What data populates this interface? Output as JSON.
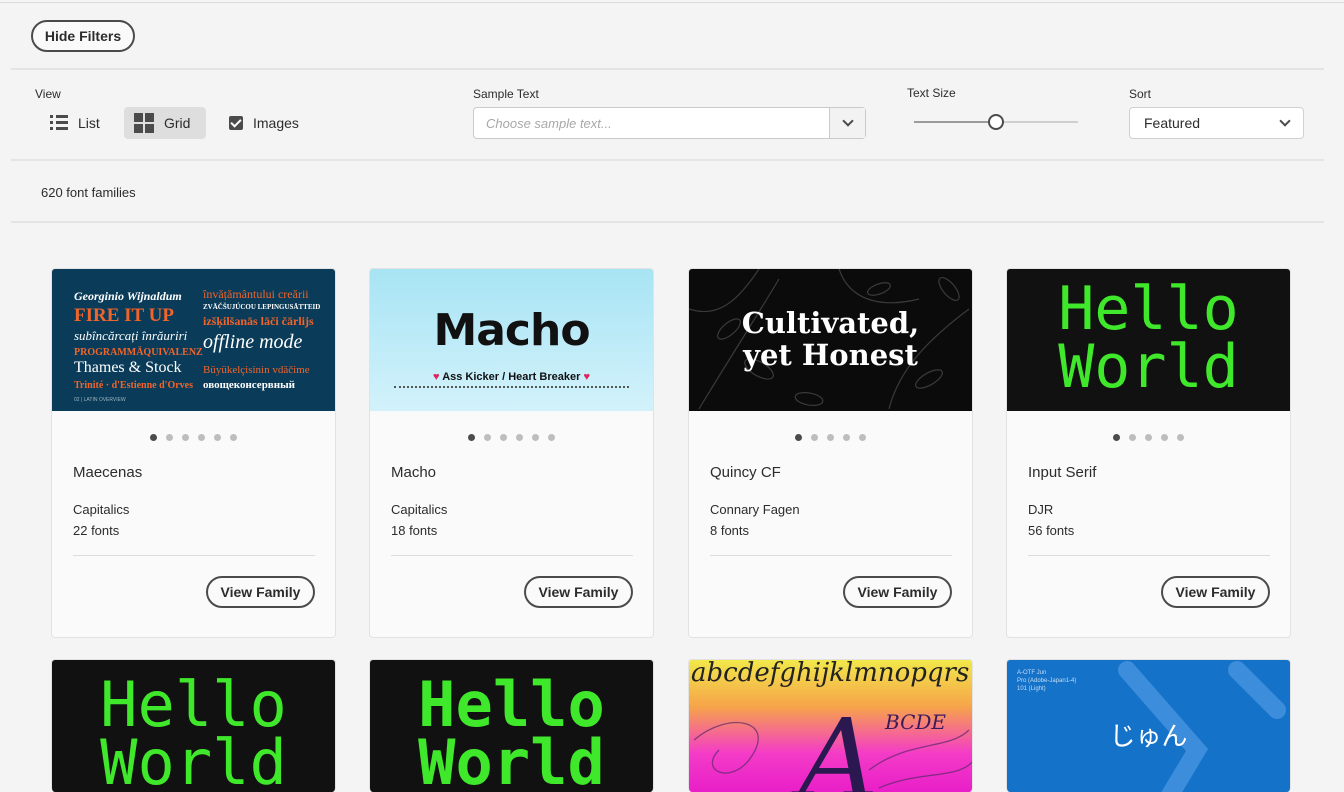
{
  "toolbar": {
    "hide_filters": "Hide Filters"
  },
  "filters": {
    "view_label": "View",
    "list_label": "List",
    "grid_label": "Grid",
    "images_label": "Images",
    "images_checked": true,
    "sample_text_label": "Sample Text",
    "sample_placeholder": "Choose sample text...",
    "text_size_label": "Text Size",
    "text_size_level": 0.5,
    "sort_label": "Sort",
    "sort_value": "Featured"
  },
  "results": {
    "count_text": "620 font families"
  },
  "cards": [
    {
      "name": "Maecenas",
      "foundry": "Capitalics",
      "fonts": "22 fonts",
      "button": "View Family",
      "thumb_lines": [
        "Georginio Wijnaldum",
        "FIRE IT UP",
        "subîncărcați înrăuriri",
        "PROGRAMMÄQUIVALENZ",
        "Thames & Stock",
        "Trinité · d'Estienne d'Orves",
        "învățământului creării",
        "ZVÄČŠUJÚCOU LEPINGUSÄTTEID",
        "izšķilšanās lāči čārlijs",
        "offline mode",
        "Büyükelçisinin vdăčime",
        "овощеконсервный",
        "02 | LATIN OVERVIEW"
      ]
    },
    {
      "name": "Macho",
      "foundry": "Capitalics",
      "fonts": "18 fonts",
      "button": "View Family",
      "thumb_title": "Macho",
      "thumb_sub": "Ass Kicker / Heart Breaker"
    },
    {
      "name": "Quincy CF",
      "foundry": "Connary Fagen",
      "fonts": "8 fonts",
      "button": "View Family",
      "thumb_lines": [
        "Cultivated,",
        "yet Honest"
      ]
    },
    {
      "name": "Input Serif",
      "foundry": "DJR",
      "fonts": "56 fonts",
      "button": "View Family",
      "thumb_lines": [
        "Hello",
        "World"
      ]
    }
  ],
  "row2": [
    {
      "thumb_lines": [
        "Hello",
        "World"
      ]
    },
    {
      "thumb_lines": [
        "Hello",
        "World"
      ]
    },
    {
      "thumb_lines": [
        "abcdefghijklmnopqrs",
        "BCDE",
        "A"
      ]
    },
    {
      "thumb_lines": [
        "A-OTF Jun",
        "Pro (Adobe-Japan1-4)",
        "101 (Light)",
        "じゅん"
      ]
    }
  ],
  "colors": {
    "accent_green": "#3fe82b",
    "maecenas_bg": "#0a3c59",
    "jun_bg": "#1472c9"
  },
  "icons": {
    "list": "list-icon",
    "grid": "grid-icon",
    "check": "checkbox-icon",
    "chevron": "chevron-down-icon"
  }
}
